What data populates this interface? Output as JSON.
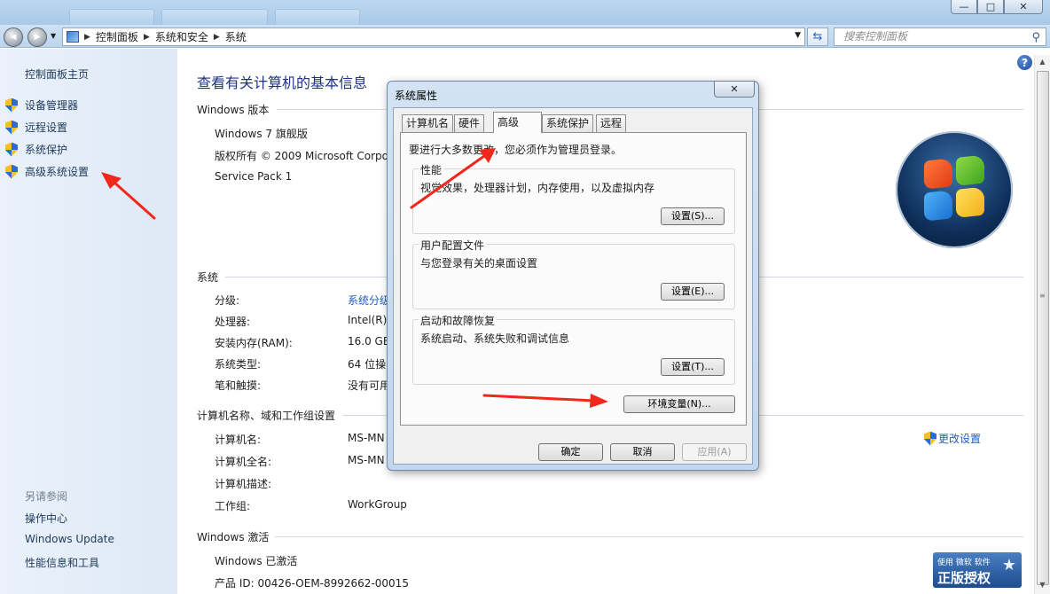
{
  "window": {
    "minimize_glyph": "—",
    "maximize_glyph": "□",
    "close_glyph": "✕"
  },
  "navbar": {
    "back_glyph": "◀",
    "forward_glyph": "▶",
    "breadcrumbs": [
      "控制面板",
      "系统和安全",
      "系统"
    ],
    "search_placeholder": "搜索控制面板"
  },
  "sidebar": {
    "home": "控制面板主页",
    "tasks": [
      "设备管理器",
      "远程设置",
      "系统保护",
      "高级系统设置"
    ],
    "see_also_title": "另请参阅",
    "see_also": [
      "操作中心",
      "Windows Update",
      "性能信息和工具"
    ]
  },
  "main": {
    "title": "查看有关计算机的基本信息",
    "edition": {
      "heading": "Windows 版本",
      "name": "Windows 7 旗舰版",
      "copyright": "版权所有 © 2009 Microsoft Corpo",
      "service_pack": "Service Pack 1"
    },
    "system": {
      "heading": "系统",
      "rows": [
        {
          "label": "分级:",
          "value": "系统分级"
        },
        {
          "label": "处理器:",
          "value": "Intel(R)"
        },
        {
          "label": "安装内存(RAM):",
          "value": "16.0 GB"
        },
        {
          "label": "系统类型:",
          "value": "64 位操"
        },
        {
          "label": "笔和触摸:",
          "value": "没有可用"
        }
      ]
    },
    "computer": {
      "heading": "计算机名称、域和工作组设置",
      "rows": [
        {
          "label": "计算机名:",
          "value": "MS-MN"
        },
        {
          "label": "计算机全名:",
          "value": "MS-MN"
        },
        {
          "label": "计算机描述:",
          "value": ""
        },
        {
          "label": "工作组:",
          "value": "WorkGroup"
        }
      ],
      "change_settings": "更改设置"
    },
    "activation": {
      "heading": "Windows 激活",
      "status": "Windows 已激活",
      "product_id": "产品 ID: 00426-OEM-8992662-00015"
    },
    "genuine_badge": {
      "top": "使用 微软 软件",
      "big": "正版授权"
    },
    "help_glyph": "?"
  },
  "dialog": {
    "title": "系统属性",
    "close_glyph": "✕",
    "tabs": [
      "计算机名",
      "硬件",
      "高级",
      "系统保护",
      "远程"
    ],
    "notice": "要进行大多数更改，您必须作为管理员登录。",
    "groups": [
      {
        "title": "性能",
        "desc": "视觉效果，处理器计划，内存使用，以及虚拟内存",
        "button": "设置(S)..."
      },
      {
        "title": "用户配置文件",
        "desc": "与您登录有关的桌面设置",
        "button": "设置(E)..."
      },
      {
        "title": "启动和故障恢复",
        "desc": "系统启动、系统失败和调试信息",
        "button": "设置(T)..."
      }
    ],
    "env_button": "环境变量(N)...",
    "ok": "确定",
    "cancel": "取消",
    "apply": "应用(A)"
  },
  "colors": {
    "link": "#1f5fbf",
    "title": "#1e3287",
    "annotation_arrow": "#f0271a"
  }
}
